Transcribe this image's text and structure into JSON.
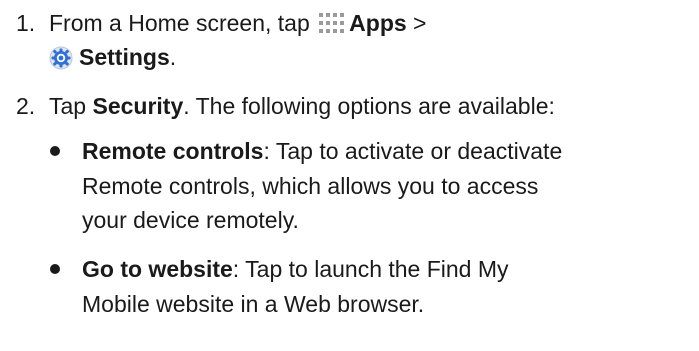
{
  "steps": [
    {
      "number": "1.",
      "line1_text": "From a Home screen, tap",
      "apps_label": "Apps",
      "separator": ">",
      "settings_label": "Settings",
      "settings_period": "."
    },
    {
      "number": "2.",
      "tap_text": "Tap",
      "security_label": "Security",
      "rest_text": ". The following options are available:"
    }
  ],
  "options": [
    {
      "title": "Remote controls",
      "line1_rest": ": Tap to activate or deactivate",
      "line2": "Remote controls, which allows you to access",
      "line3": "your device remotely."
    },
    {
      "title": "Go to website",
      "line1_rest": ": Tap to launch the Find My",
      "line2": "Mobile website in a Web browser."
    }
  ],
  "icons": {
    "apps": "apps-grid-icon",
    "settings": "settings-gear-icon",
    "settings_color": "#2f6fd6",
    "apps_color": "#9a9a9a"
  }
}
